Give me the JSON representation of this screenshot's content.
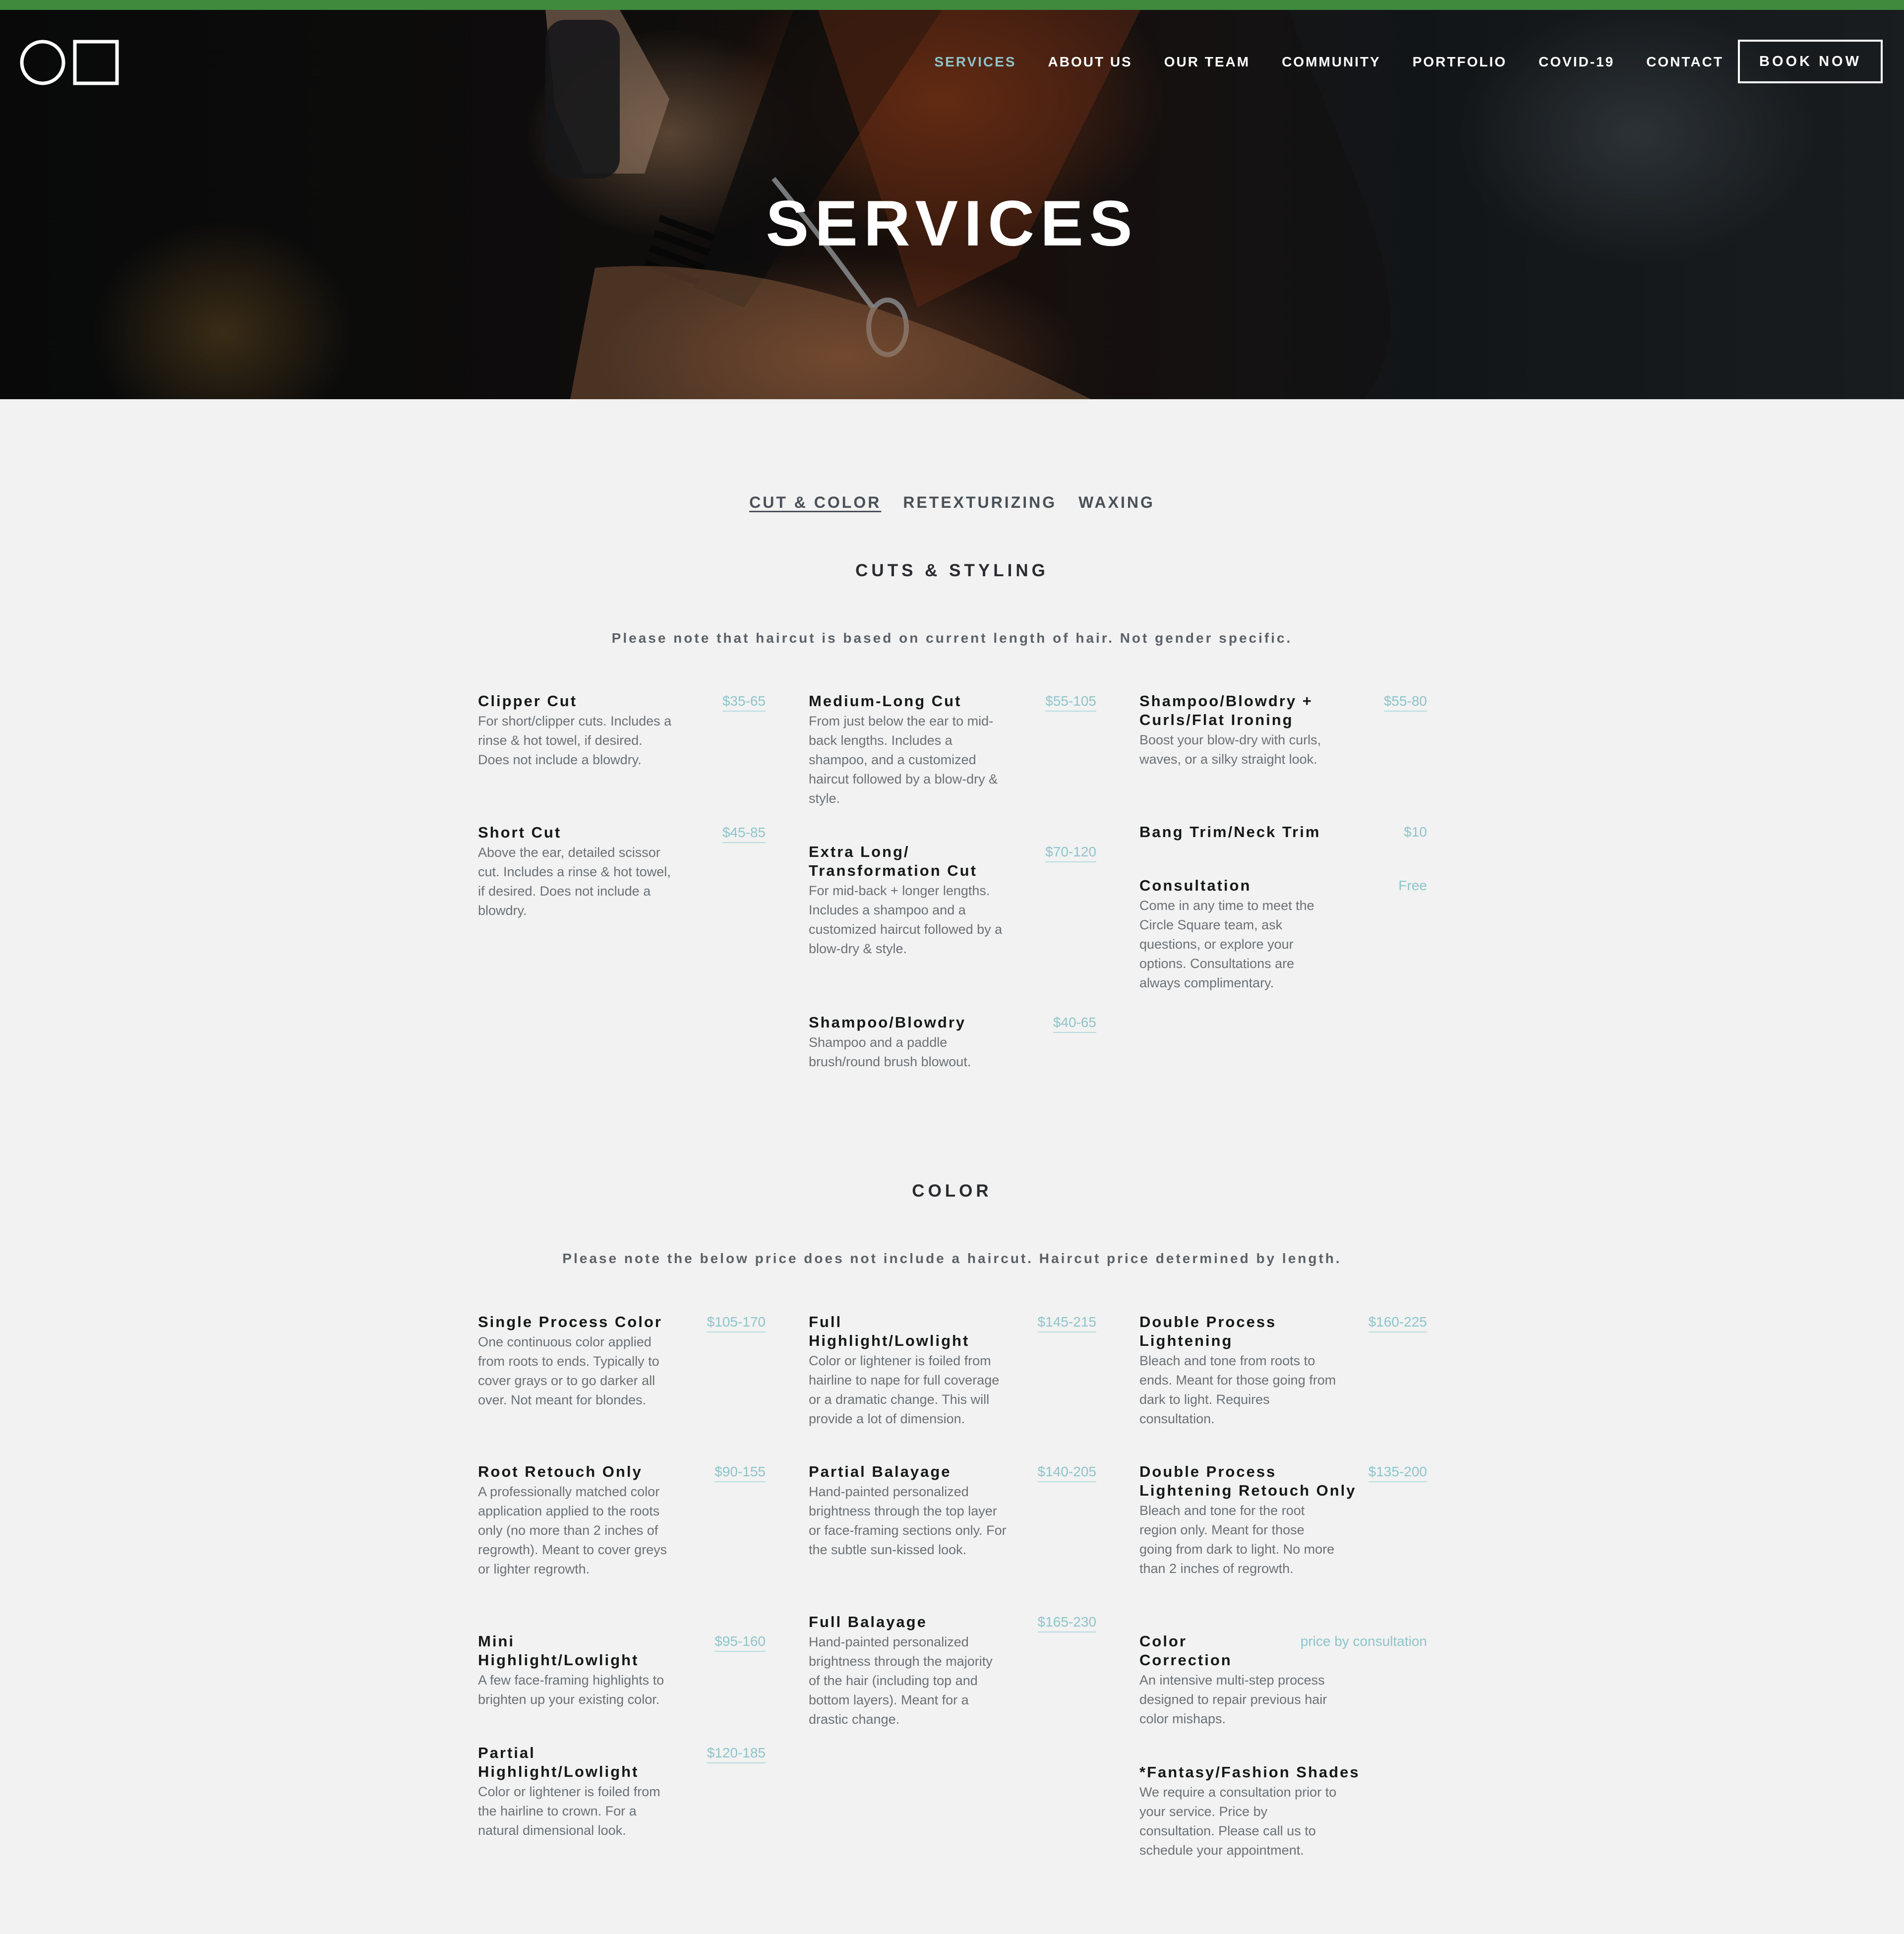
{
  "header": {
    "nav": [
      {
        "label": "SERVICES",
        "active": true
      },
      {
        "label": "ABOUT US"
      },
      {
        "label": "OUR TEAM"
      },
      {
        "label": "COMMUNITY"
      },
      {
        "label": "PORTFOLIO"
      },
      {
        "label": "COVID-19"
      },
      {
        "label": "CONTACT"
      }
    ],
    "book_button": "BOOK NOW"
  },
  "hero": {
    "title": "SERVICES"
  },
  "tabs": [
    {
      "label": "CUT & COLOR",
      "active": true
    },
    {
      "label": "RETEXTURIZING"
    },
    {
      "label": "WAXING"
    }
  ],
  "cuts": {
    "title": "CUTS & STYLING",
    "note": "Please note that haircut is based on current length of hair. Not gender specific.",
    "columns": [
      [
        {
          "name": "Clipper Cut",
          "price": "$35-65",
          "desc": "For short/clipper cuts. Includes a rinse & hot towel, if desired. Does not include a blowdry."
        },
        {
          "name": "Short Cut",
          "price": "$45-85",
          "desc": "Above the ear, detailed scissor cut. Includes a rinse & hot towel, if desired. Does not include a blowdry."
        }
      ],
      [
        {
          "name": "Medium-Long Cut",
          "price": "$55-105",
          "desc": "From just below the ear to mid-back lengths. Includes a shampoo, and a customized haircut followed by a blow-dry & style."
        },
        {
          "name": "Extra Long/ Transformation Cut",
          "price": "$70-120",
          "desc": "For mid-back + longer lengths. Includes a shampoo and a customized haircut followed by a blow-dry & style."
        },
        {
          "name": "Shampoo/Blowdry",
          "price": "$40-65",
          "desc": "Shampoo and a paddle brush/round brush blowout."
        }
      ],
      [
        {
          "name": "Shampoo/Blowdry + Curls/Flat Ironing",
          "price": "$55-80",
          "desc": "Boost your blow-dry with curls, waves, or a silky straight look."
        },
        {
          "name": "Bang Trim/Neck Trim",
          "price": "$10",
          "desc": ""
        },
        {
          "name": "Consultation",
          "price": "Free",
          "desc": "Come in any time to meet the Circle Square team, ask questions, or explore your options. Consultations are always complimentary."
        }
      ]
    ]
  },
  "color": {
    "title": "COLOR",
    "note": "Please note the below price does not include a haircut. Haircut price determined by length.",
    "columns": [
      [
        {
          "name": "Single Process Color",
          "price": "$105-170",
          "desc": "One continuous color applied from roots to ends. Typically to cover grays or to go darker all over. Not meant for blondes."
        },
        {
          "name": "Root Retouch Only",
          "price": "$90-155",
          "desc": "A professionally matched color application applied to the roots only (no more than 2 inches of regrowth). Meant to cover greys or lighter regrowth."
        },
        {
          "name": "Mini Highlight/Lowlight",
          "price": "$95-160",
          "desc": "A few face-framing highlights to brighten up your existing color."
        },
        {
          "name": "Partial Highlight/Lowlight",
          "price": "$120-185",
          "desc": "Color or lightener is foiled from the hairline to crown. For a natural dimensional look."
        }
      ],
      [
        {
          "name": "Full Highlight/Lowlight",
          "price": "$145-215",
          "desc": "Color or lightener is foiled from hairline to nape for full coverage or a dramatic change. This will provide a lot of dimension."
        },
        {
          "name": "Partial Balayage",
          "price": "$140-205",
          "desc": "Hand-painted personalized brightness through the top layer or face-framing sections only. For the subtle sun-kissed look."
        },
        {
          "name": "Full Balayage",
          "price": "$165-230",
          "desc": "Hand-painted personalized brightness through the majority of the hair (including top and bottom layers). Meant for a drastic change."
        }
      ],
      [
        {
          "name": "Double Process Lightening",
          "price": "$160-225",
          "desc": "Bleach and tone from roots to ends. Meant for those going from dark to light. Requires consultation."
        },
        {
          "name": "Double Process Lightening Retouch Only",
          "price": "$135-200",
          "desc": "Bleach and tone for the root region only. Meant for those going from dark to light. No more than 2 inches of regrowth."
        },
        {
          "name": "Color Correction",
          "price": "price by consultation",
          "desc": "An intensive multi-step process designed to repair previous hair color mishaps."
        },
        {
          "name": "*Fantasy/Fashion Shades",
          "price": "",
          "desc": "We require a consultation prior to your service. Price by consultation. Please call us to schedule your appointment."
        }
      ]
    ]
  }
}
